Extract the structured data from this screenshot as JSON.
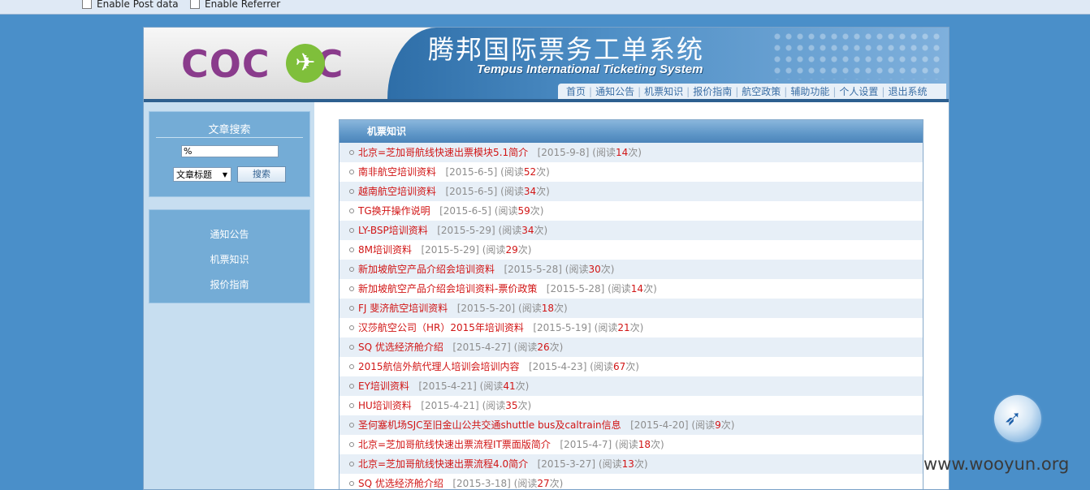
{
  "toolbar": {
    "enable_post_data": "Enable Post data",
    "enable_referrer": "Enable Referrer"
  },
  "header": {
    "logo_text": "COC",
    "logo_tail": "C",
    "title_cn": "腾邦国际票务工单系统",
    "title_en": "Tempus International Ticketing System",
    "nav": [
      "首页",
      "通知公告",
      "机票知识",
      "报价指南",
      "航空政策",
      "辅助功能",
      "个人设置",
      "退出系统"
    ]
  },
  "sidebar": {
    "search_title": "文章搜索",
    "search_value": "%",
    "search_field_selected": "文章标题",
    "search_button": "搜索",
    "menu": [
      "通知公告",
      "机票知识",
      "报价指南"
    ]
  },
  "content": {
    "heading": "机票知识",
    "articles": [
      {
        "title": "北京=芝加哥航线快速出票模块5.1简介",
        "date": "[2015-9-8]",
        "reads": "14"
      },
      {
        "title": "南非航空培训资料",
        "date": "[2015-6-5]",
        "reads": "52"
      },
      {
        "title": "越南航空培训资料",
        "date": "[2015-6-5]",
        "reads": "34"
      },
      {
        "title": "TG换开操作说明",
        "date": "[2015-6-5]",
        "reads": "59"
      },
      {
        "title": "LY-BSP培训资料",
        "date": "[2015-5-29]",
        "reads": "34"
      },
      {
        "title": "8M培训资料",
        "date": "[2015-5-29]",
        "reads": "29"
      },
      {
        "title": "新加坡航空产品介绍会培训资料",
        "date": "[2015-5-28]",
        "reads": "30"
      },
      {
        "title": "新加坡航空产品介绍会培训资料-票价政策",
        "date": "[2015-5-28]",
        "reads": "14"
      },
      {
        "title": "FJ 斐济航空培训资料",
        "date": "[2015-5-20]",
        "reads": "18"
      },
      {
        "title": "汉莎航空公司（HR）2015年培训资料",
        "date": "[2015-5-19]",
        "reads": "21"
      },
      {
        "title": "SQ 优选经济舱介绍",
        "date": "[2015-4-27]",
        "reads": "26"
      },
      {
        "title": "2015航信外航代理人培训会培训内容",
        "date": "[2015-4-23]",
        "reads": "67"
      },
      {
        "title": "EY培训资料",
        "date": "[2015-4-21]",
        "reads": "41"
      },
      {
        "title": "HU培训资料",
        "date": "[2015-4-21]",
        "reads": "35"
      },
      {
        "title": "圣何塞机场SJC至旧金山公共交通shuttle bus及caltrain信息",
        "date": "[2015-4-20]",
        "reads": "9"
      },
      {
        "title": "北京=芝加哥航线快速出票流程IT票面版简介",
        "date": "[2015-4-7]",
        "reads": "18"
      },
      {
        "title": "北京=芝加哥航线快速出票流程4.0简介",
        "date": "[2015-3-27]",
        "reads": "13"
      },
      {
        "title": "SQ 优选经济舱介绍",
        "date": "[2015-3-18]",
        "reads": "27"
      }
    ],
    "read_prefix": "(阅读",
    "read_suffix": "次)"
  },
  "watermark": {
    "text": "www.wooyun.org"
  }
}
